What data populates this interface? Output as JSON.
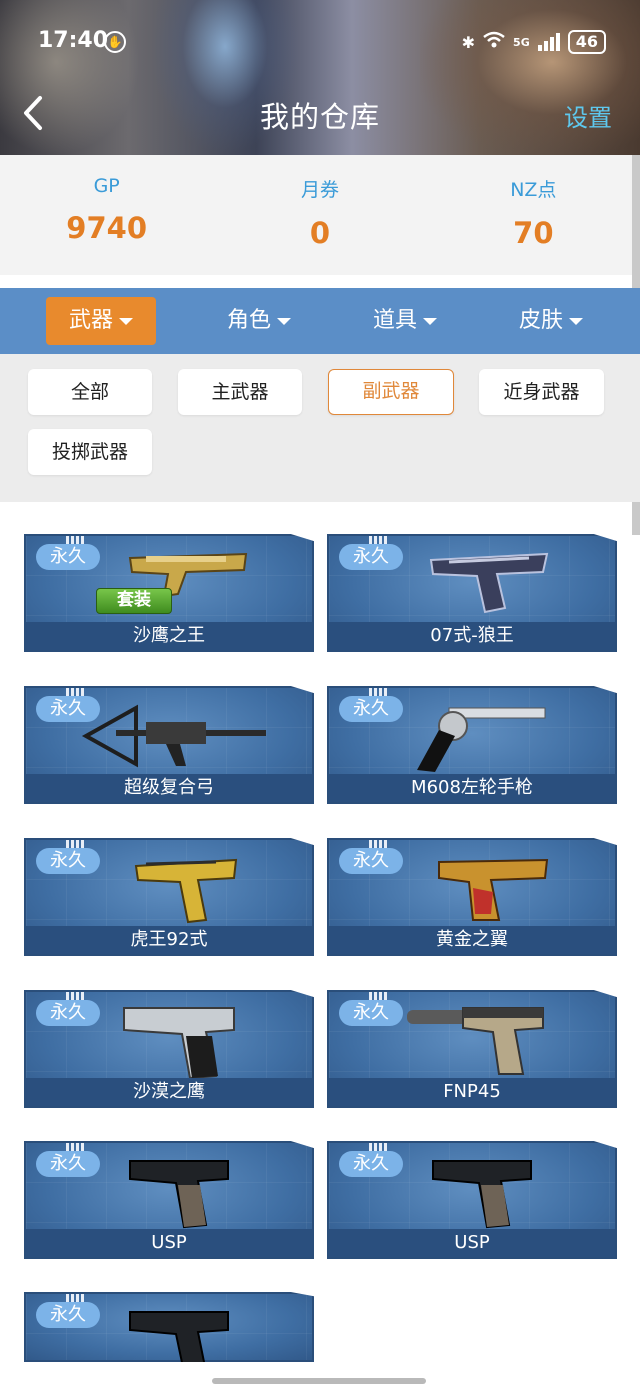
{
  "status_bar": {
    "time": "17:40",
    "network": "5G",
    "battery": "46"
  },
  "nav": {
    "title": "我的仓库",
    "settings": "设置"
  },
  "currency": [
    {
      "label": "GP",
      "value": "9740"
    },
    {
      "label": "月券",
      "value": "0"
    },
    {
      "label": "NZ点",
      "value": "70"
    }
  ],
  "categories": [
    "武器",
    "角色",
    "道具",
    "皮肤"
  ],
  "subfilters": [
    "全部",
    "主武器",
    "副武器",
    "近身武器",
    "投掷武器"
  ],
  "badge_label": "永久",
  "set_tag": "套装",
  "items": [
    {
      "name": "沙鹰之王",
      "badge": "永久",
      "tag": "套装"
    },
    {
      "name": "07式-狼王",
      "badge": "永久"
    },
    {
      "name": "超级复合弓",
      "badge": "永久"
    },
    {
      "name": "M608左轮手枪",
      "badge": "永久"
    },
    {
      "name": "虎王92式",
      "badge": "永久"
    },
    {
      "name": "黄金之翼",
      "badge": "永久"
    },
    {
      "name": "沙漠之鹰",
      "badge": "永久"
    },
    {
      "name": "FNP45",
      "badge": "永久"
    },
    {
      "name": "USP",
      "badge": "永久"
    },
    {
      "name": "USP",
      "badge": "永久"
    },
    {
      "name": "",
      "badge": "永久"
    }
  ],
  "colors": {
    "accent": "#e88a2d",
    "category_bar": "#5b8ec7",
    "value_orange": "#e37e24",
    "label_blue": "#3a9bd8"
  }
}
